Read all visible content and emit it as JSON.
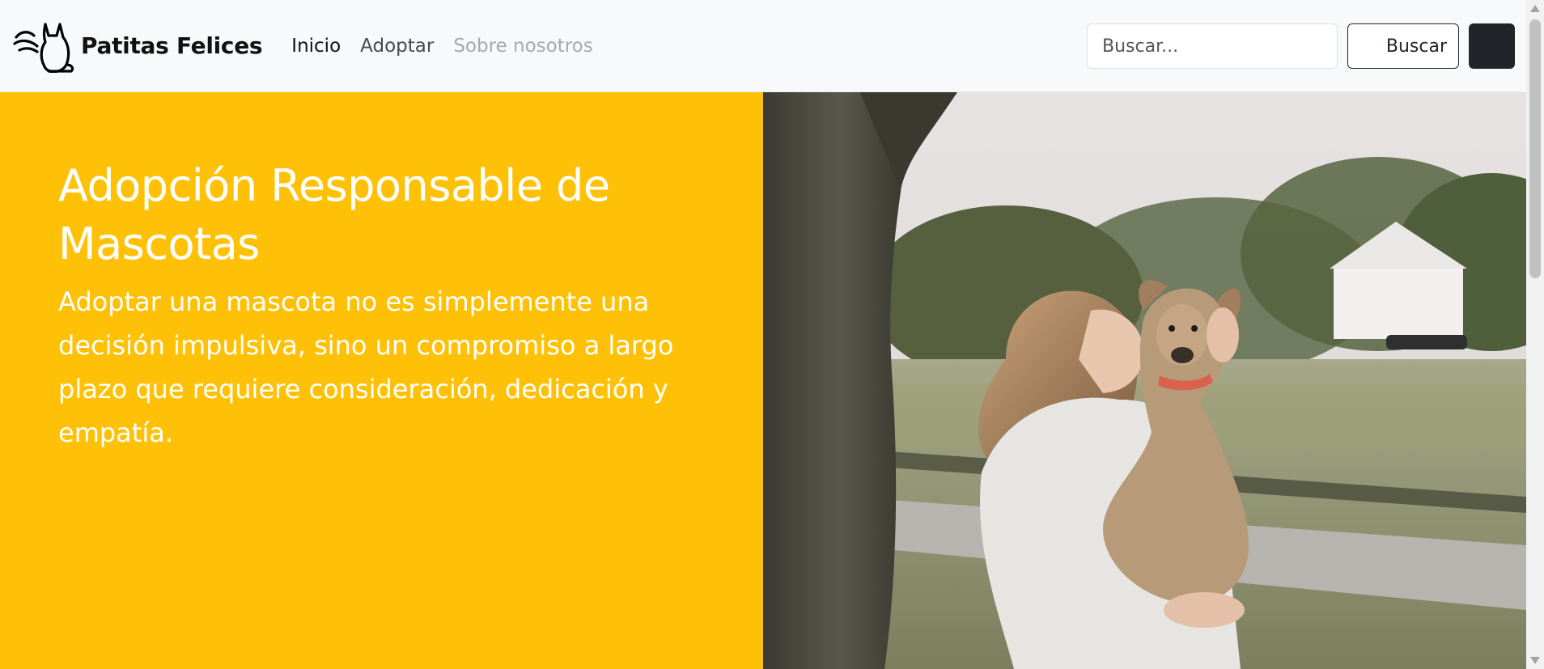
{
  "navbar": {
    "brand_name": "Patitas Felices",
    "logo_icon": "cat-with-hand-logo-icon",
    "links": [
      {
        "label": "Inicio",
        "state": "active"
      },
      {
        "label": "Adoptar",
        "state": "normal"
      },
      {
        "label": "Sobre nosotros",
        "state": "disabled"
      }
    ],
    "search": {
      "placeholder": "Buscar...",
      "value": "",
      "button_label": "Buscar"
    }
  },
  "hero": {
    "title": "Adopción Responsable de Mascotas",
    "text": "Adoptar una mascota no es simplemente una decisión impulsiva, sino un compromiso a largo plazo que requiere consideración, dedicación y empatía.",
    "background_color": "#ffc107",
    "image_icon": "woman-holding-dog-photo"
  },
  "colors": {
    "navbar_bg": "#f8f9fa",
    "hero_bg": "#ffc107",
    "dark_button": "#212529"
  }
}
